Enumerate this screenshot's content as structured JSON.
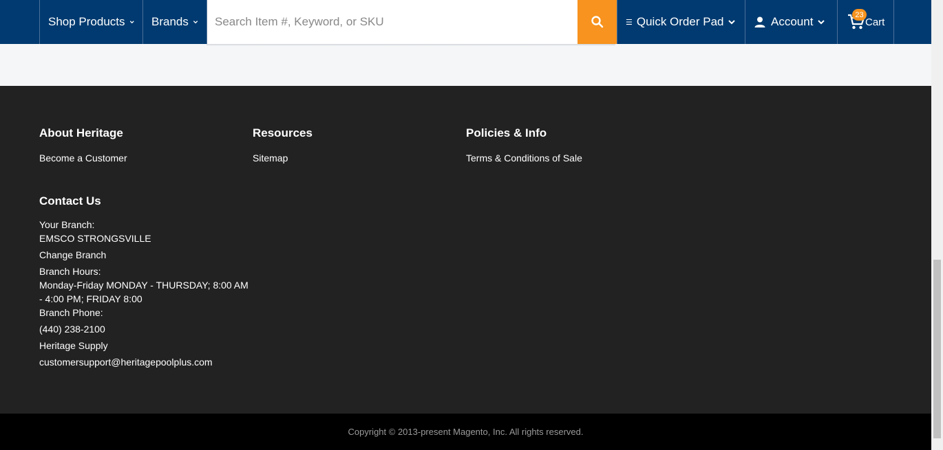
{
  "header": {
    "shop_products": "Shop Products",
    "brands": "Brands",
    "search_placeholder": "Search Item #, Keyword, or SKU",
    "quick_order_pad": "Quick Order Pad",
    "account": "Account",
    "cart_label": "Cart",
    "cart_count": "23"
  },
  "footer": {
    "about": {
      "heading": "About Heritage",
      "links": [
        "Become a Customer"
      ]
    },
    "resources": {
      "heading": "Resources",
      "links": [
        "Sitemap"
      ]
    },
    "policies": {
      "heading": "Policies & Info",
      "links": [
        "Terms & Conditions of Sale"
      ]
    },
    "contact": {
      "heading": "Contact Us",
      "branch_label": "Your Branch:",
      "branch_name": "EMSCO STRONGSVILLE",
      "change_branch": "Change Branch",
      "hours_label": "Branch Hours:",
      "hours_value": "Monday-Friday MONDAY - THURSDAY; 8:00 AM - 4:00 PM; FRIDAY 8:00",
      "phone_label": "Branch Phone:",
      "phone": "(440) 238-2100",
      "company": "Heritage Supply",
      "email": "customersupport@heritagepoolplus.com"
    },
    "copyright": "Copyright © 2013-present Magento, Inc. All rights reserved."
  },
  "colors": {
    "header_bg": "#003a70",
    "accent": "#f7931e",
    "footer_bg": "#222222"
  }
}
